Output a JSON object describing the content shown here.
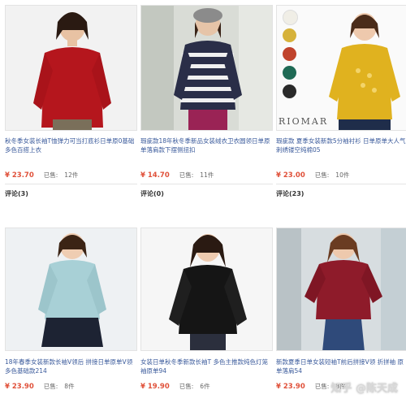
{
  "colors": {
    "price": "#e0513a",
    "title_link": "#3a5a9b"
  },
  "products": [
    {
      "title": "秋冬季女装长袖T恤弹力可当打底衫日单原0基础多色百搭上衣",
      "price": "¥ 23.70",
      "sold_label": "已售:",
      "sold_count": "12件",
      "reviews": "评论(3)",
      "top_color": "#b5161d"
    },
    {
      "title": "瑕疵款18年秋冬季新品女装绒衣卫衣圆领日单原单落肩款下摆侧扭扣",
      "price": "¥ 14.70",
      "sold_label": "已售:",
      "sold_count": "11件",
      "reviews": "评论(0)",
      "top_color": "#2a2e48"
    },
    {
      "title": "瑕疵款 夏季女装新款5分袖衬衫 日单原单大人气刺绣镂空纯棉05",
      "price": "¥ 23.00",
      "sold_label": "已售:",
      "sold_count": "10件",
      "reviews": "评论(23)",
      "top_color": "#e0b21f",
      "brand": "RIOMAR",
      "swatches": [
        "#f0eee6",
        "#d6b23a",
        "#c0432c",
        "#1f6a55",
        "#2a2a2a"
      ]
    },
    {
      "title": "18年春季女装新款长袖V领后 拼接日单原单V领多色基础款214",
      "price": "¥ 23.90",
      "sold_label": "已售:",
      "sold_count": "8件",
      "top_color": "#a8d0d6"
    },
    {
      "title": "女装日单秋冬季新款长袖T 多色主推款纯色灯笼袖原单94",
      "price": "¥ 19.90",
      "sold_label": "已售:",
      "sold_count": "6件",
      "top_color": "#151515"
    },
    {
      "title": "新款夏季日单女装短袖T前后拼接V领 折拼袖 原单落肩54",
      "price": "¥ 23.90",
      "sold_label": "已售:",
      "sold_count": "8件",
      "top_color": "#8e1b2a"
    }
  ],
  "watermark": "知乎 @陈天成"
}
